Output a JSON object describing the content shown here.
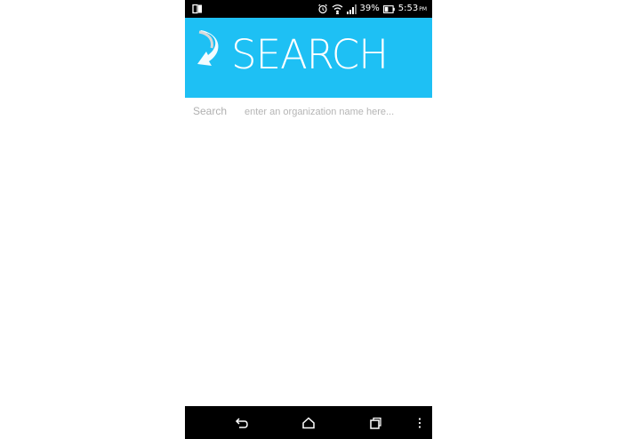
{
  "status_bar": {
    "battery_percent": "39%",
    "time": "5:53",
    "time_suffix": "PM"
  },
  "header": {
    "title": "SEARCH",
    "background_color": "#1ec0f4"
  },
  "search": {
    "label": "Search",
    "placeholder": "enter an organization name here...",
    "value": ""
  },
  "nav_bar": {
    "icons": [
      "back-icon",
      "home-icon",
      "recent-apps-icon",
      "overflow-menu-icon"
    ]
  }
}
